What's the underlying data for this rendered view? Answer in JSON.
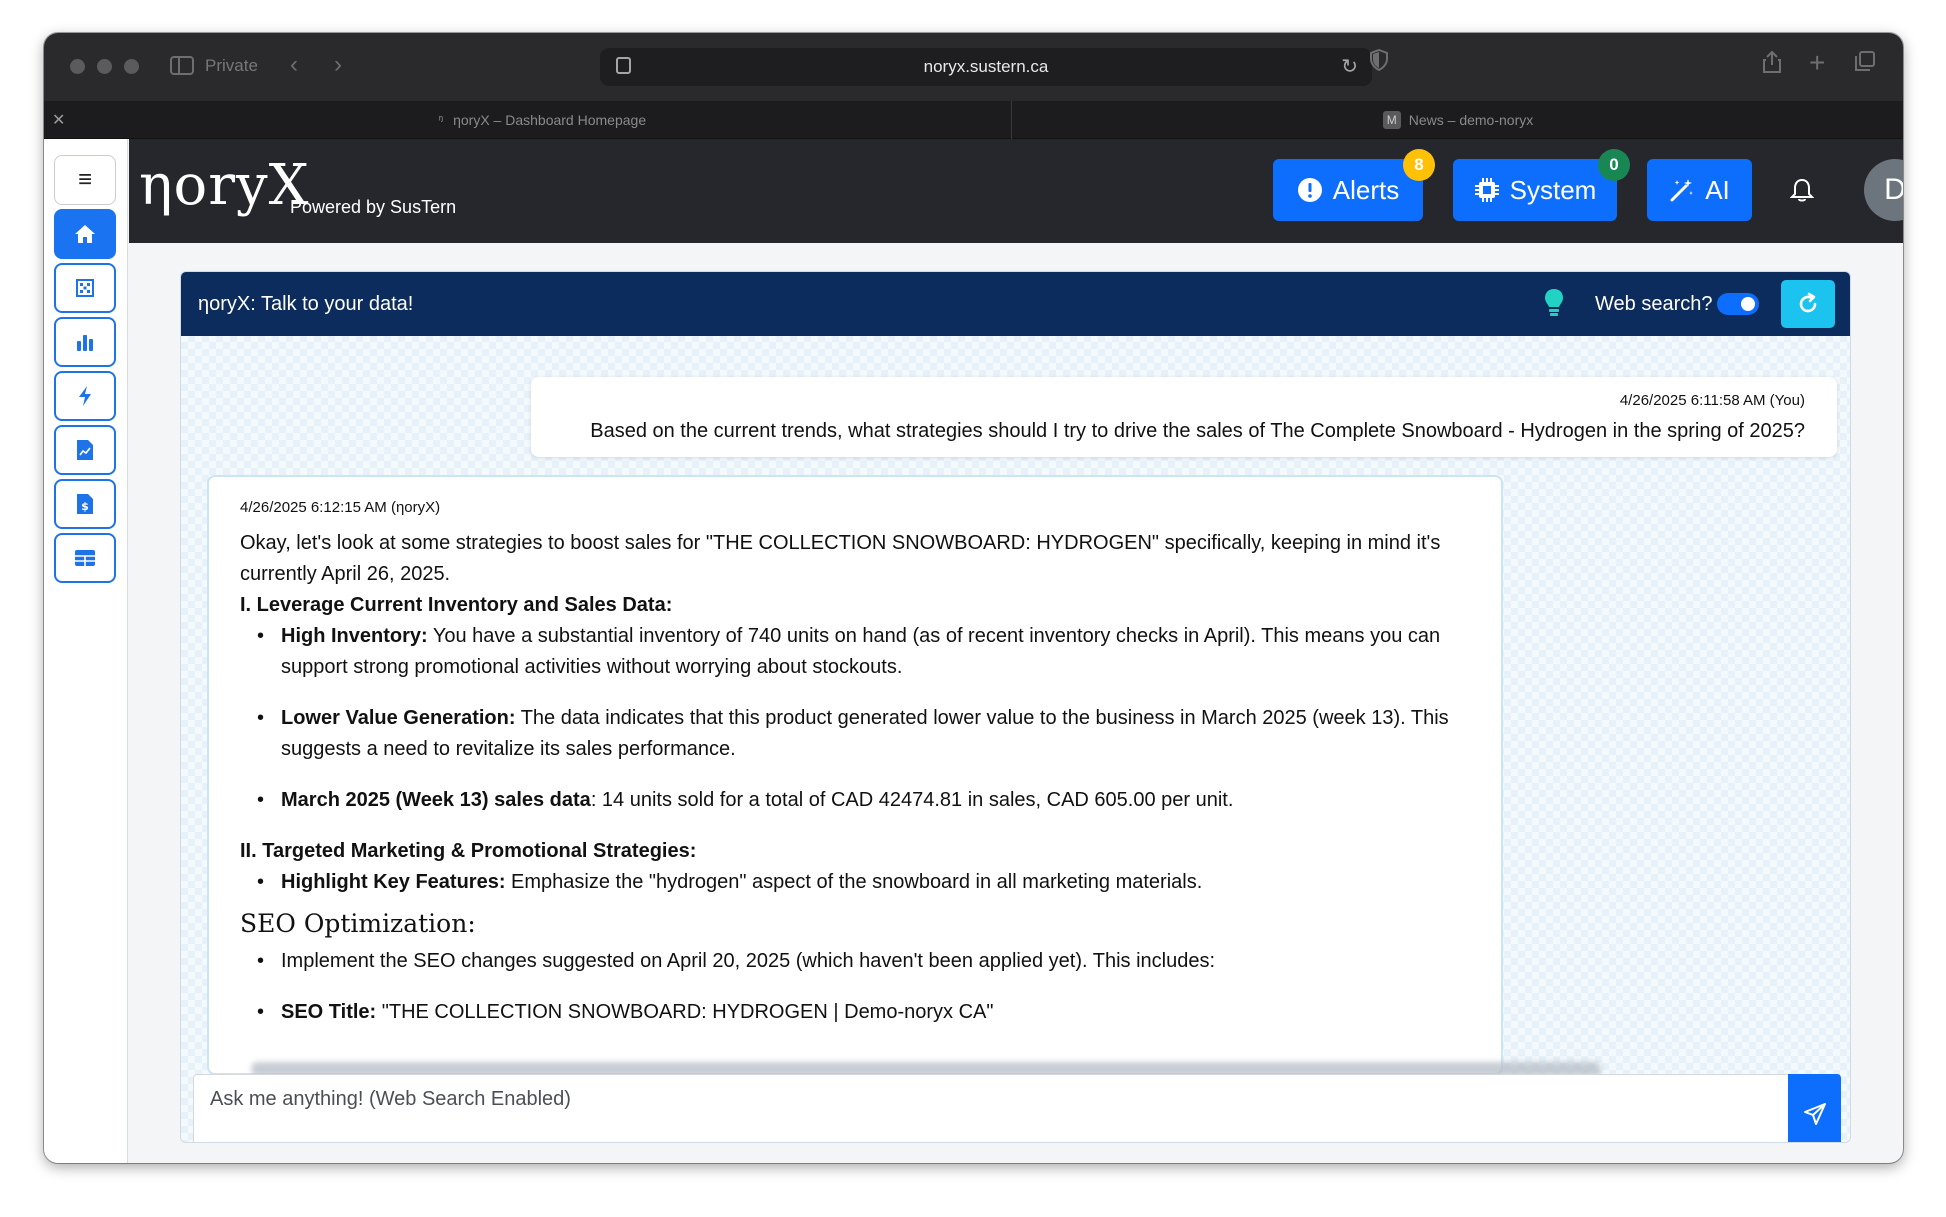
{
  "browser": {
    "private_label": "Private",
    "url": "noryx.sustern.ca",
    "tabs": [
      {
        "title": "ηoryX – Dashboard Homepage",
        "favicon": "ᵑ"
      },
      {
        "title": "News – demo-noryx",
        "favicon": "M"
      }
    ]
  },
  "header": {
    "logo": "ηoryX",
    "powered_by": "Powered by SusTern",
    "alerts_label": "Alerts",
    "alerts_count": "8",
    "system_label": "System",
    "system_count": "0",
    "ai_label": "AI",
    "avatar_initial": "D"
  },
  "chat": {
    "title": "ηoryX: Talk to your data!",
    "web_search_label": "Web search?",
    "input_placeholder": "Ask me anything! (Web Search Enabled)",
    "user_message": {
      "timestamp": "4/26/2025 6:11:58 AM (You)",
      "text": "Based on the current trends, what strategies should I try to drive the sales of The Complete Snowboard - Hydrogen in the spring of 2025?"
    },
    "bot_message": {
      "timestamp": "4/26/2025 6:12:15 AM (ηoryX)",
      "intro": "Okay, let's look at some strategies to boost sales for \"THE COLLECTION SNOWBOARD: HYDROGEN\" specifically, keeping in mind it's currently April 26, 2025.",
      "section1": "I. Leverage Current Inventory and Sales Data:",
      "s1_items": [
        {
          "bold": "High Inventory:",
          "text": " You have a substantial inventory of 740 units on hand (as of recent inventory checks in April). This means you can support strong promotional activities without worrying about stockouts."
        },
        {
          "bold": "Lower Value Generation:",
          "text": " The data indicates that this product generated lower value to the business in March 2025 (week 13). This suggests a need to revitalize its sales performance."
        },
        {
          "bold": "March 2025 (Week 13) sales data",
          "text": ": 14 units sold for a total of CAD 42474.81 in sales, CAD 605.00 per unit."
        }
      ],
      "section2": "II. Targeted Marketing & Promotional Strategies:",
      "s2_items": [
        {
          "bold": "Highlight Key Features:",
          "text": " Emphasize the \"hydrogen\" aspect of the snowboard in all marketing materials."
        }
      ],
      "seo_heading": "SEO Optimization:",
      "seo_item1": "Implement the SEO changes suggested on April 20, 2025 (which haven't been applied yet). This includes:",
      "seo_item2_bold": "SEO Title:",
      "seo_item2_text": " \"THE COLLECTION SNOWBOARD: HYDROGEN | Demo-noryx CA\""
    }
  },
  "colors": {
    "primary": "#0d6efd",
    "header_bg": "#25272c",
    "chat_header_bg": "#0b2c5c",
    "alerts_badge": "#ffc107",
    "system_badge": "#198754",
    "refresh_btn": "#1bc3ee"
  },
  "icons": {
    "sidebar": [
      "menu-icon",
      "home-icon",
      "grid-icon",
      "bar-chart-icon",
      "lightning-icon",
      "document-chart-icon",
      "invoice-dollar-icon",
      "table-icon"
    ]
  }
}
